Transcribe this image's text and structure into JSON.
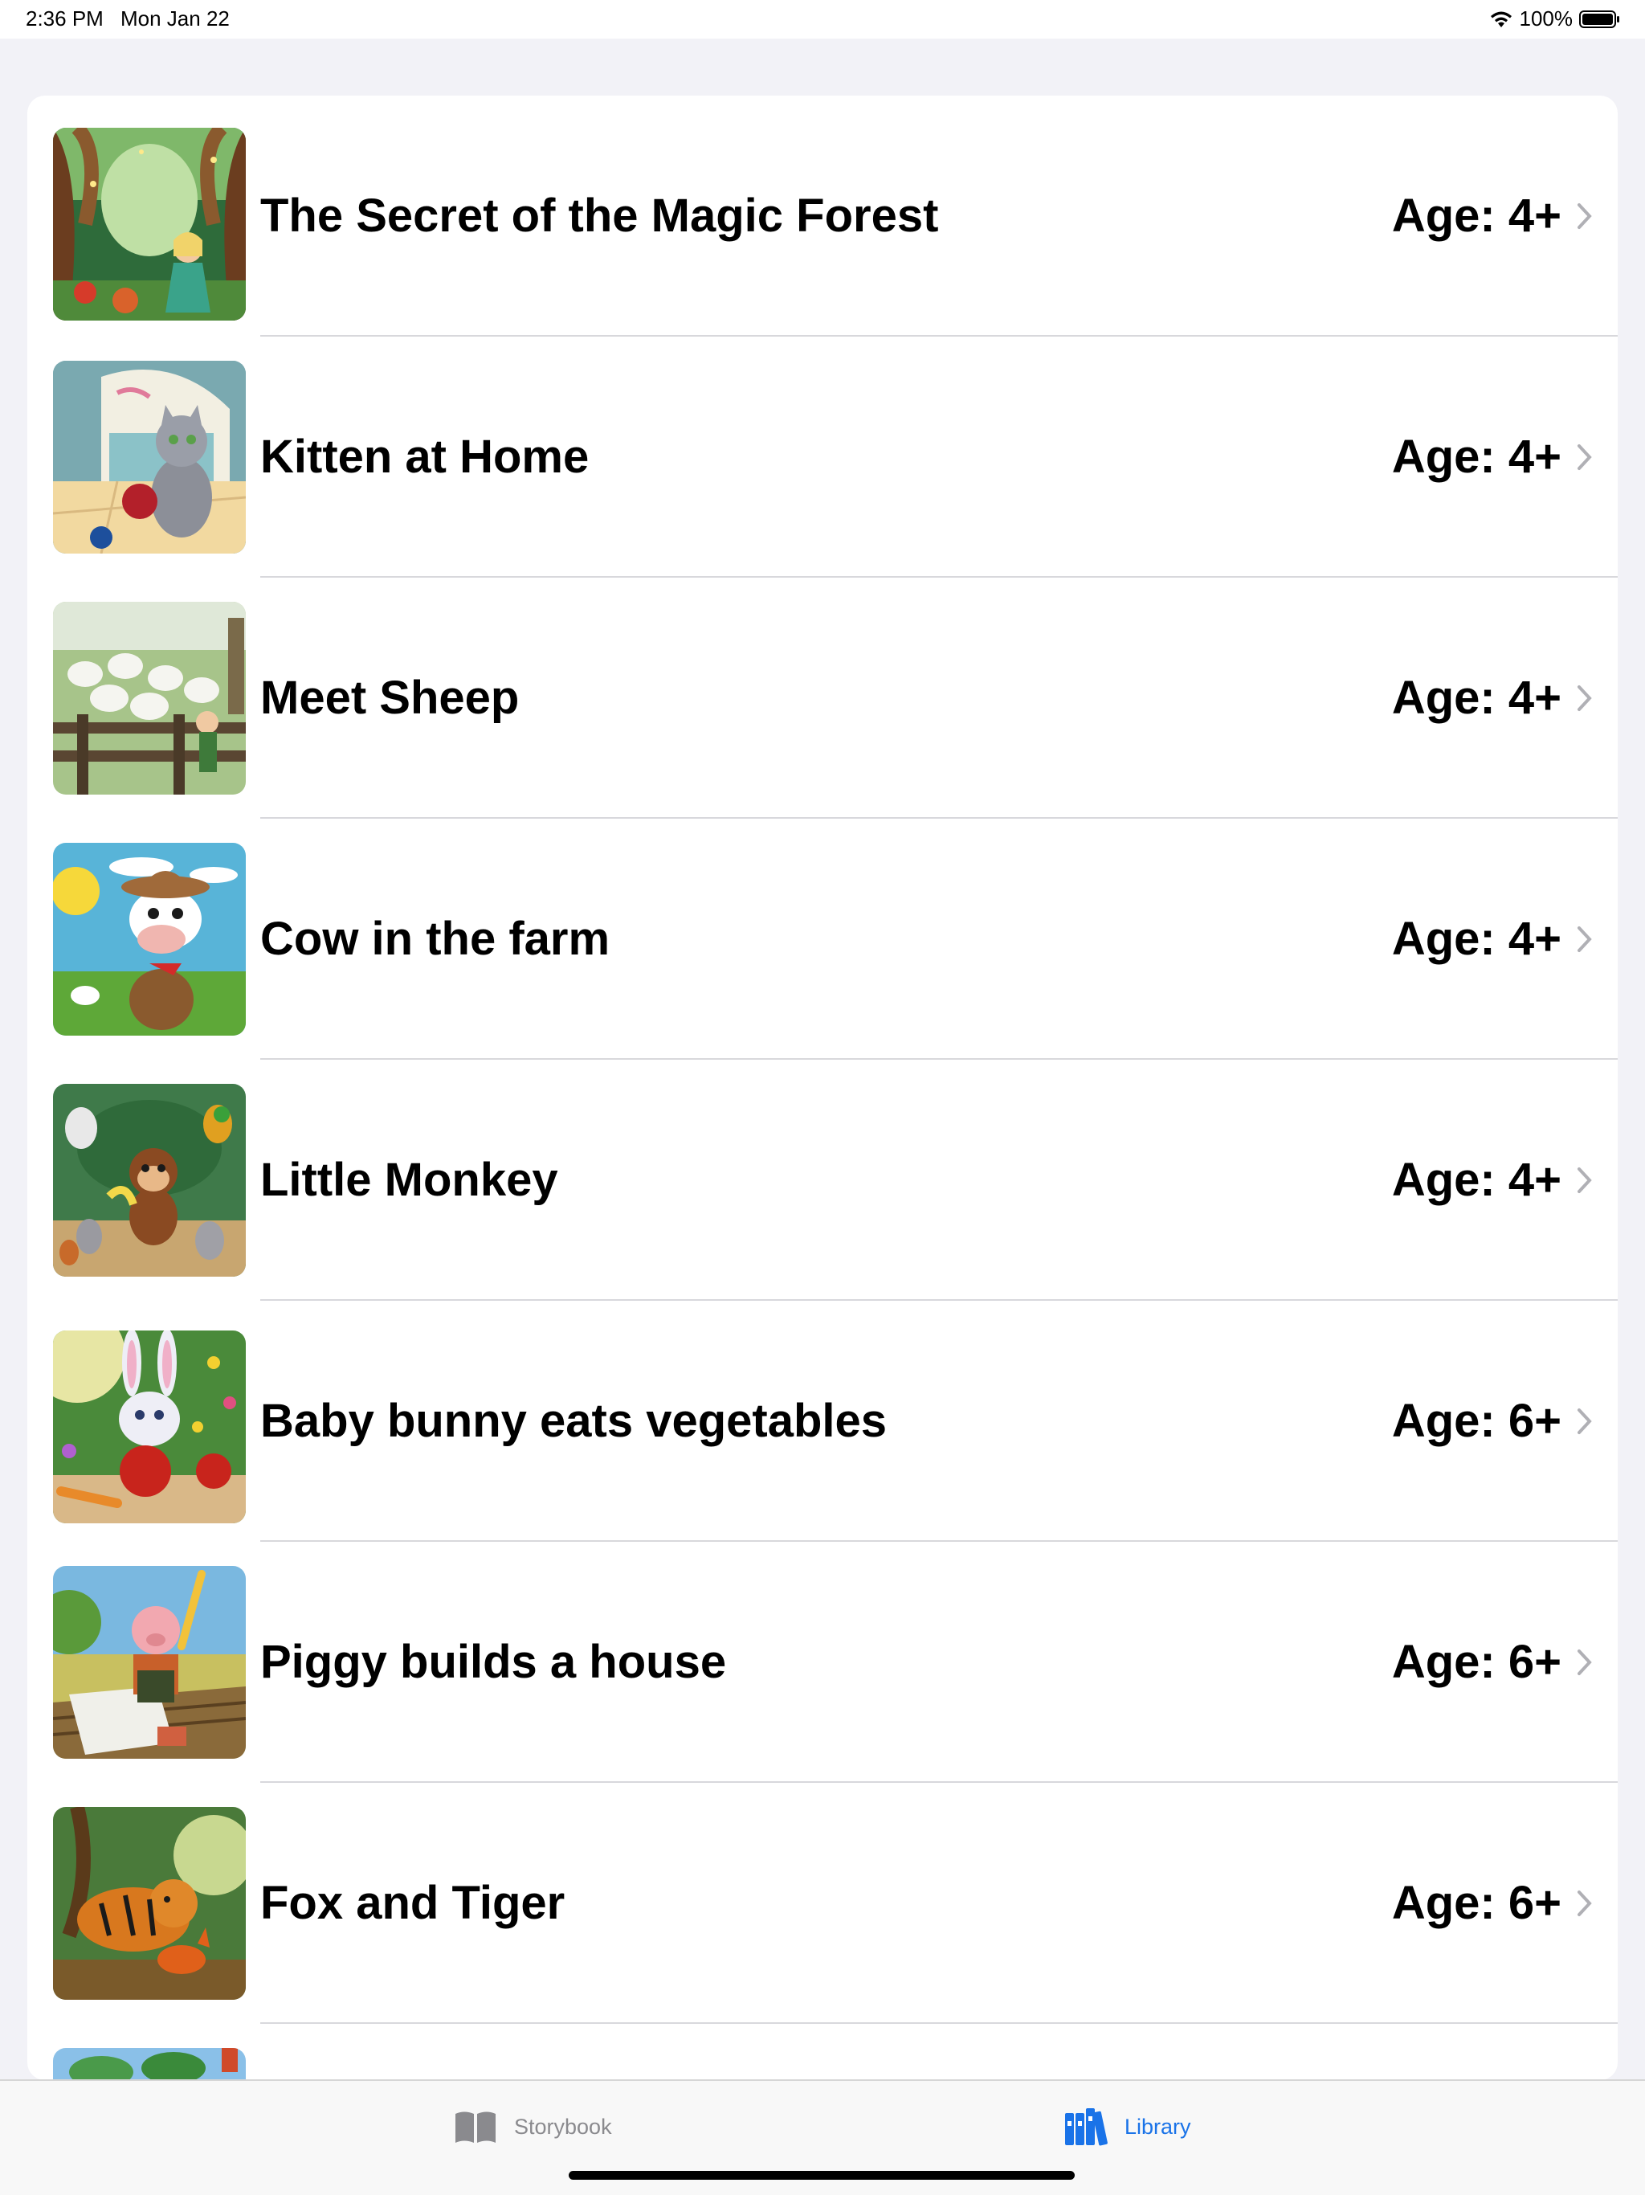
{
  "status_bar": {
    "time": "2:36 PM",
    "date": "Mon Jan 22",
    "battery": "100%"
  },
  "stories": [
    {
      "title": "The Secret of the Magic Forest",
      "age": "Age: 4+",
      "thumb_icon": "magic-forest-illustration"
    },
    {
      "title": "Kitten at Home",
      "age": "Age: 4+",
      "thumb_icon": "kitten-illustration"
    },
    {
      "title": "Meet Sheep",
      "age": "Age: 4+",
      "thumb_icon": "sheep-illustration"
    },
    {
      "title": "Cow in the farm",
      "age": "Age: 4+",
      "thumb_icon": "cow-illustration"
    },
    {
      "title": "Little Monkey",
      "age": "Age: 4+",
      "thumb_icon": "monkey-illustration"
    },
    {
      "title": "Baby bunny eats vegetables",
      "age": "Age: 6+",
      "thumb_icon": "bunny-illustration"
    },
    {
      "title": "Piggy builds a house",
      "age": "Age: 6+",
      "thumb_icon": "piggy-illustration"
    },
    {
      "title": "Fox and Tiger",
      "age": "Age: 6+",
      "thumb_icon": "fox-tiger-illustration"
    }
  ],
  "tab_bar": {
    "tabs": [
      {
        "label": "Storybook",
        "icon": "book-icon",
        "selected": false
      },
      {
        "label": "Library",
        "icon": "books-icon",
        "selected": true
      }
    ]
  },
  "colors": {
    "accent": "#1a73e8",
    "background": "#f2f2f7",
    "inactive_tab": "#8a8a8e"
  }
}
